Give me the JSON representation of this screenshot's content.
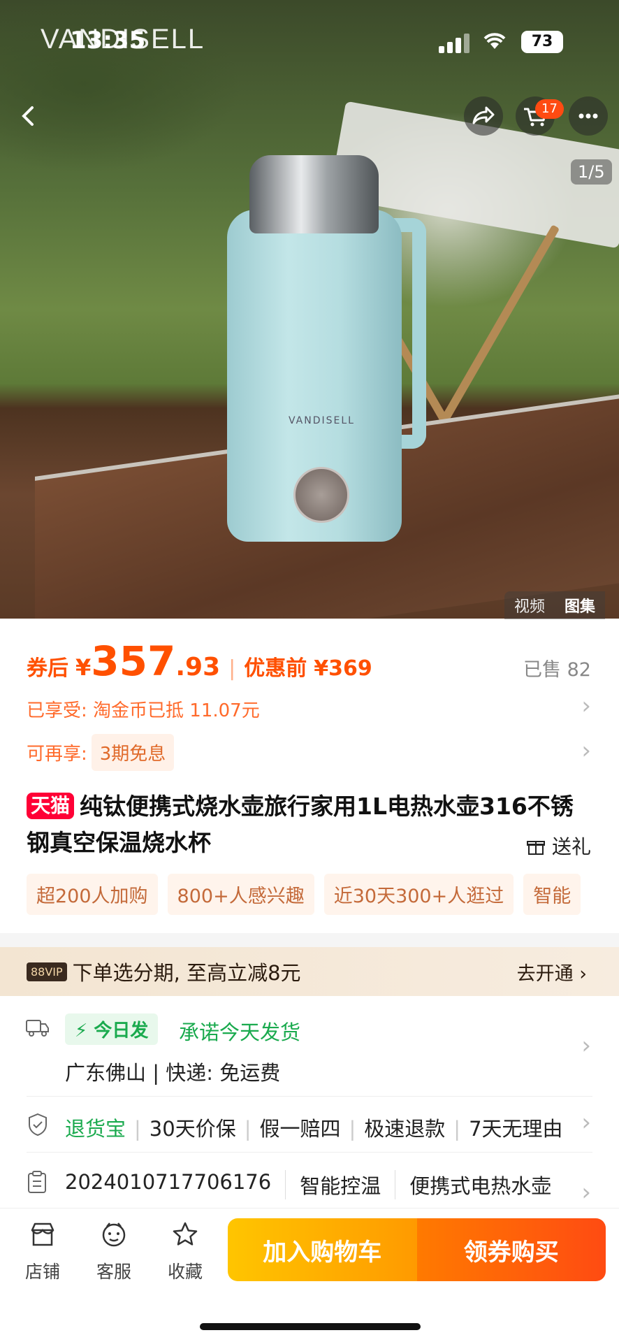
{
  "status": {
    "time": "13:35",
    "battery": "73",
    "brand_overlay": "VANDISELL"
  },
  "gallery": {
    "pager": "1/5",
    "cart_count": "17",
    "tabs": [
      "视频",
      "图集"
    ],
    "product_brand": "VANDISELL"
  },
  "price": {
    "after_coupon_label": "券后",
    "currency": "¥",
    "after_coupon_int": "357",
    "after_coupon_dec": ".93",
    "separator": "|",
    "before_label": "优惠前",
    "before_value": "¥369",
    "sold": "已售 82"
  },
  "benefits": {
    "enjoyed": "已享受: 淘金币已抵 11.07元",
    "more_label": "可再享:",
    "more_value": "3期免息"
  },
  "product": {
    "badge": "天猫",
    "title": "纯钛便携式烧水壶旅行家用1L电热水壶316不锈钢真空保温烧水杯",
    "gift": "送礼",
    "tags": [
      "超200人加购",
      "800+人感兴趣",
      "近30天300+人逛过",
      "智能"
    ]
  },
  "vip": {
    "badge": "88VIP",
    "text": "下单选分期, 至高立减8元",
    "action": "去开通"
  },
  "shipping": {
    "today_badge": "今日发",
    "promise": "承诺今天发货",
    "origin": "广东佛山 | 快递: 免运费"
  },
  "service": {
    "main": "退货宝",
    "items": [
      "30天价保",
      "假一赔四",
      "极速退款",
      "7天无理由"
    ]
  },
  "specs": [
    "2024010717706176",
    "智能控温",
    "便携式电热水壶"
  ],
  "bottom_bar": {
    "tabs": [
      {
        "label": "店铺",
        "icon": "store-icon"
      },
      {
        "label": "客服",
        "icon": "service-icon"
      },
      {
        "label": "收藏",
        "icon": "star-icon"
      }
    ],
    "add_cart": "加入购物车",
    "buy": "领券购买"
  },
  "colors": {
    "accent": "#ff5000",
    "green": "#1aaa4e",
    "tmall": "#ff0036"
  }
}
